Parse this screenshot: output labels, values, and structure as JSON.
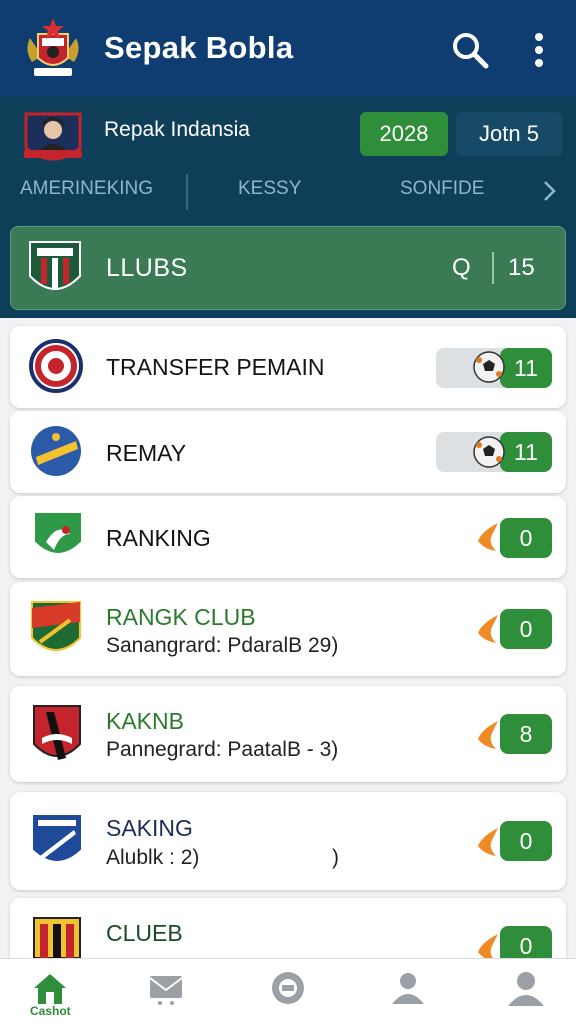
{
  "app": {
    "title": "Sepak Bobla"
  },
  "profile": {
    "name": "Repak Indansia",
    "year_badge": "2028",
    "join_badge": "Jotn 5"
  },
  "categories": [
    "AMERINEKING",
    "KESSY",
    "SONFIDE"
  ],
  "banner": {
    "label": "LLUBS",
    "search_glyph": "Q",
    "count": "15"
  },
  "items": [
    {
      "title": "TRANSFER PEMAIN",
      "subtitle": "",
      "badge": "11"
    },
    {
      "title": "REMAY",
      "subtitle": "",
      "badge": "11"
    },
    {
      "title": "RANKING",
      "subtitle": "",
      "badge": "0"
    },
    {
      "title": "RANGK CLUB",
      "subtitle": "Sanangrard: PdaralB 29)",
      "badge": "0"
    },
    {
      "title": "KAKNB",
      "subtitle": "Pannegrard: PaatalB - 3)",
      "badge": "8"
    },
    {
      "title": "SAKING",
      "subtitle": "Alublk : 2)",
      "subtitle_tail": ")",
      "badge": "0"
    },
    {
      "title": "CLUEB",
      "subtitle": "",
      "badge": "0"
    }
  ],
  "bottom_nav": [
    {
      "icon": "home-icon",
      "label": "Cashot",
      "active": true
    },
    {
      "icon": "mail-icon",
      "label": "",
      "active": false
    },
    {
      "icon": "ball-icon",
      "label": "",
      "active": false
    },
    {
      "icon": "person-icon",
      "label": "",
      "active": false
    },
    {
      "icon": "profile-icon",
      "label": "",
      "active": false
    }
  ],
  "colors": {
    "appbar": "#0f3d72",
    "subheader": "#0f3e58",
    "accent_green": "#2e8e3a",
    "flame_orange": "#f08a24"
  }
}
